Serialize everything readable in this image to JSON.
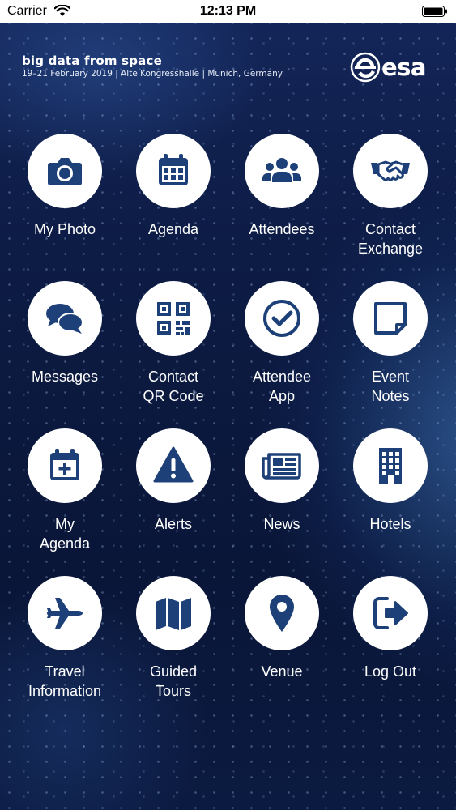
{
  "status_bar": {
    "carrier": "Carrier",
    "time": "12:13 PM"
  },
  "banner": {
    "title": "big data from space",
    "subtitle": "19–21 February 2019 | Alte Kongresshalle | Munich, Germany",
    "logo_text": "esa"
  },
  "colors": {
    "icon": "#1e4078",
    "circle": "#ffffff",
    "label": "#ffffff"
  },
  "tiles": [
    {
      "label": "My Photo",
      "icon": "camera-icon"
    },
    {
      "label": "Agenda",
      "icon": "calendar-icon"
    },
    {
      "label": "Attendees",
      "icon": "people-icon"
    },
    {
      "label": "Contact\nExchange",
      "icon": "handshake-icon"
    },
    {
      "label": "Messages",
      "icon": "chat-bubbles-icon"
    },
    {
      "label": "Contact\nQR Code",
      "icon": "qr-code-icon"
    },
    {
      "label": "Attendee\nApp",
      "icon": "check-circle-icon"
    },
    {
      "label": "Event\nNotes",
      "icon": "sticky-note-icon"
    },
    {
      "label": "My\nAgenda",
      "icon": "calendar-plus-icon"
    },
    {
      "label": "Alerts",
      "icon": "warning-icon"
    },
    {
      "label": "News",
      "icon": "newspaper-icon"
    },
    {
      "label": "Hotels",
      "icon": "building-icon"
    },
    {
      "label": "Travel\nInformation",
      "icon": "airplane-icon"
    },
    {
      "label": "Guided\nTours",
      "icon": "map-icon"
    },
    {
      "label": "Venue",
      "icon": "location-pin-icon"
    },
    {
      "label": "Log Out",
      "icon": "logout-icon"
    }
  ]
}
